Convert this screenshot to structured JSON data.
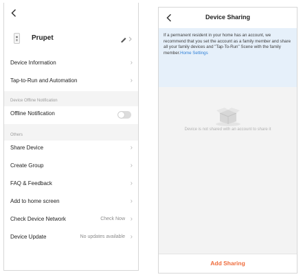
{
  "device_settings": {
    "back_icon": "chevron-left-icon",
    "device_icon": "device-plug-icon",
    "edit_icon": "pencil-icon",
    "device_name": "Prupet",
    "rows": {
      "device_information": "Device Information",
      "tap_to_run": "Tap-to-Run and Automation",
      "offline_notification": "Offline Notification",
      "share_device": "Share Device",
      "create_group": "Create Group",
      "faq_feedback": "FAQ & Feedback",
      "add_to_home": "Add to home screen",
      "check_network": "Check Device Network",
      "device_update": "Device Update"
    },
    "check_network_value": "Check Now",
    "device_update_value": "No updates available",
    "section_offline": "Device Offline Notification",
    "section_others": "Others",
    "offline_notification_enabled": false
  },
  "device_sharing": {
    "title": "Device Sharing",
    "back_icon": "chevron-left-icon",
    "info_text": "If a permanent resident in your home has an account, we recommend that you set the account as a family member and share all your family devices and \"Tap-To-Run\" Scene with the family member.",
    "info_link": "Home Settings",
    "empty_icon": "empty-box-icon",
    "empty_text": "Device is not shared with an account to share it",
    "add_sharing": "Add Sharing"
  },
  "colors": {
    "accent": "#ef6b3b",
    "link": "#2f7fd6",
    "info_bg": "#e6f0fa",
    "toggle_off": "#dcdcdc"
  }
}
